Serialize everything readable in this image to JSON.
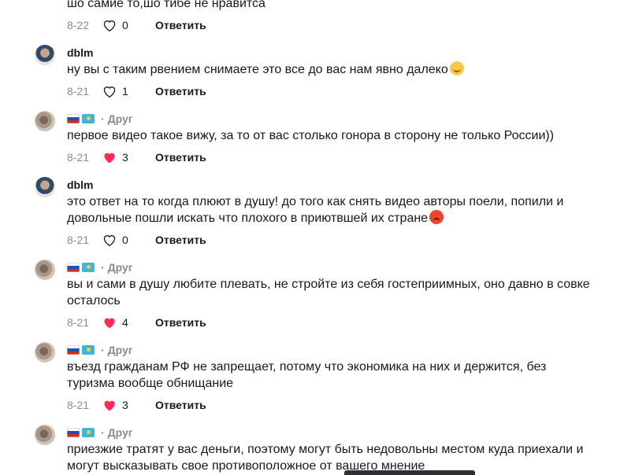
{
  "top_partial": {
    "text": "шо самие то,шо тибе не нравитса",
    "date": "8-22",
    "likes": "0",
    "liked": false,
    "reply": "Ответить"
  },
  "comments": [
    {
      "user": "dblm",
      "avatar": "girl",
      "text": "ну вы с таким рвением снимаете это все до вас нам явно далеко",
      "emoji": "smile",
      "date": "8-21",
      "likes": "1",
      "liked": false,
      "reply": "Ответить"
    },
    {
      "user": "",
      "friend": "Друг",
      "flags": [
        "ru",
        "kz"
      ],
      "avatar": "cat",
      "text": "первое видео такое вижу, за то от вас столько гонора в сторону не только России))",
      "date": "8-21",
      "likes": "3",
      "liked": true,
      "reply": "Ответить"
    },
    {
      "user": "dblm",
      "avatar": "girl",
      "text": "это ответ на то когда плюют в душу! до того как снять видео авторы поели, попили и довольные пошли искать что плохого в приютвшей их стране",
      "emoji": "angry",
      "date": "8-21",
      "likes": "0",
      "liked": false,
      "reply": "Ответить"
    },
    {
      "friend": "Друг",
      "flags": [
        "ru",
        "kz"
      ],
      "avatar": "cat",
      "text": "вы и сами в душу любите плевать, не стройте из себя гостеприимных, оно давно в совке осталось",
      "date": "8-21",
      "likes": "4",
      "liked": true,
      "reply": "Ответить"
    },
    {
      "friend": "Друг",
      "flags": [
        "ru",
        "kz"
      ],
      "avatar": "cat",
      "text": "въезд гражданам РФ не запрещает, потому что экономика на них и держится, без туризма вообще обнищание",
      "date": "8-21",
      "likes": "3",
      "liked": true,
      "reply": "Ответить"
    },
    {
      "friend": "Друг",
      "flags": [
        "ru",
        "kz"
      ],
      "avatar": "cat",
      "text": "приезжие тратят у вас деньги, поэтому могут быть недовольны местом куда приехали и могут высказывать свое противоположное от вашего мнение"
    }
  ],
  "colors": {
    "liked_heart": "#fe2c55",
    "muted": "#8a8b91",
    "text": "#161823"
  },
  "icons": {
    "like": "heart-icon",
    "separator": "dot"
  }
}
